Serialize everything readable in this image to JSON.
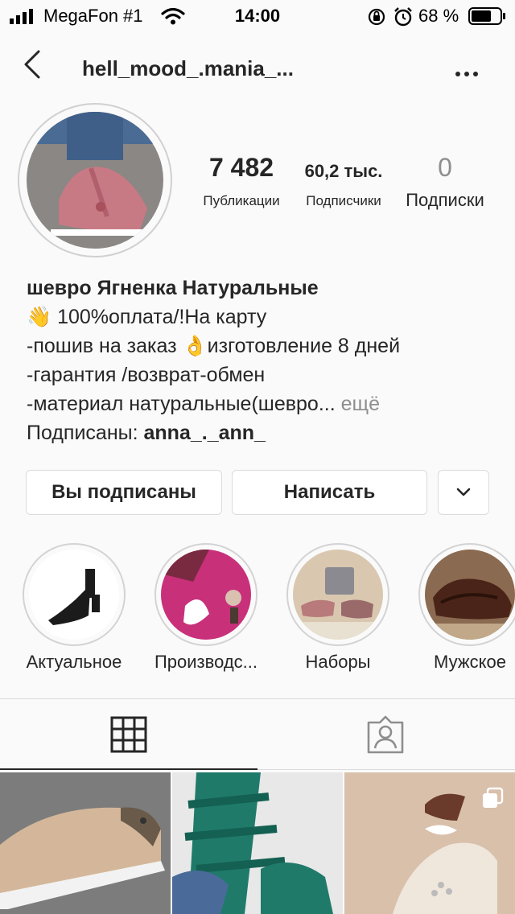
{
  "status_bar": {
    "carrier": "MegaFon #1",
    "time": "14:00",
    "battery": "68 %"
  },
  "nav": {
    "username": "hell_mood_.mania_..."
  },
  "stats": [
    {
      "value": "7 482",
      "label": "Публикации"
    },
    {
      "value": "60,2 тыс.",
      "label": "Подписчики"
    },
    {
      "value": "0",
      "label": "Подписки"
    }
  ],
  "bio": {
    "name": "шевро Ягненка Натуральные",
    "line1": "👋 100%оплата/!На карту",
    "line2": "-пошив на заказ 👌изготовление 8 дней",
    "line3": "-гарантия /возврат-обмен",
    "line4": "-материал натуральные(шевро...",
    "more": "ещё",
    "followed_by_prefix": "Подписаны:",
    "followed_by_user": "anna_._ann_"
  },
  "actions": {
    "following": "Вы подписаны",
    "message": "Написать"
  },
  "highlights": [
    {
      "label": "Актуальное"
    },
    {
      "label": "Производс..."
    },
    {
      "label": "Наборы"
    },
    {
      "label": "Мужское"
    }
  ],
  "colors": {
    "text": "#262626",
    "secondary": "#8e8e8e",
    "border": "#dbdbdb",
    "background": "#fafafa"
  }
}
